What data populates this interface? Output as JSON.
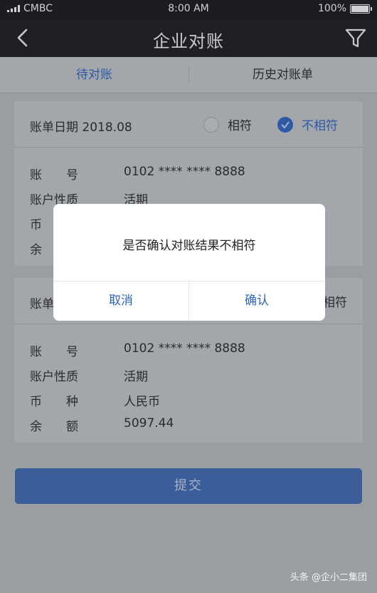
{
  "status_bar": {
    "carrier": "CMBC",
    "time": "8:00 AM",
    "battery": "100%"
  },
  "nav": {
    "title": "企业对账",
    "back_icon": "chevron-left-icon",
    "filter_icon": "filter-icon"
  },
  "tabs": [
    {
      "label": "待对账",
      "active": true
    },
    {
      "label": "历史对账单",
      "active": false
    }
  ],
  "statements": [
    {
      "date": "账单日期 2018.08",
      "option_match": "相符",
      "option_mismatch": "不相符",
      "fields": [
        {
          "key": "账　　号",
          "value": "0102 **** **** 8888"
        },
        {
          "key": "账户性质",
          "value": "活期"
        },
        {
          "key": "币",
          "value": ""
        },
        {
          "key": "余",
          "value": ""
        }
      ]
    },
    {
      "date": "账单",
      "option_match": "",
      "option_mismatch": "相符",
      "fields": [
        {
          "key": "账　　号",
          "value": "0102 **** **** 8888"
        },
        {
          "key": "账户性质",
          "value": "活期"
        },
        {
          "key": "币　　种",
          "value": "人民币"
        },
        {
          "key": "余　　额",
          "value": "5097.44"
        }
      ]
    }
  ],
  "submit_label": "提交",
  "dialog": {
    "message": "是否确认对账结果不相符",
    "cancel_label": "取消",
    "confirm_label": "确认"
  },
  "watermark": "头条 @企小二集团",
  "colors": {
    "accent": "#2e5aa5",
    "dialog_button": "#2e64c2",
    "submit_bg": "#3b5d99"
  }
}
